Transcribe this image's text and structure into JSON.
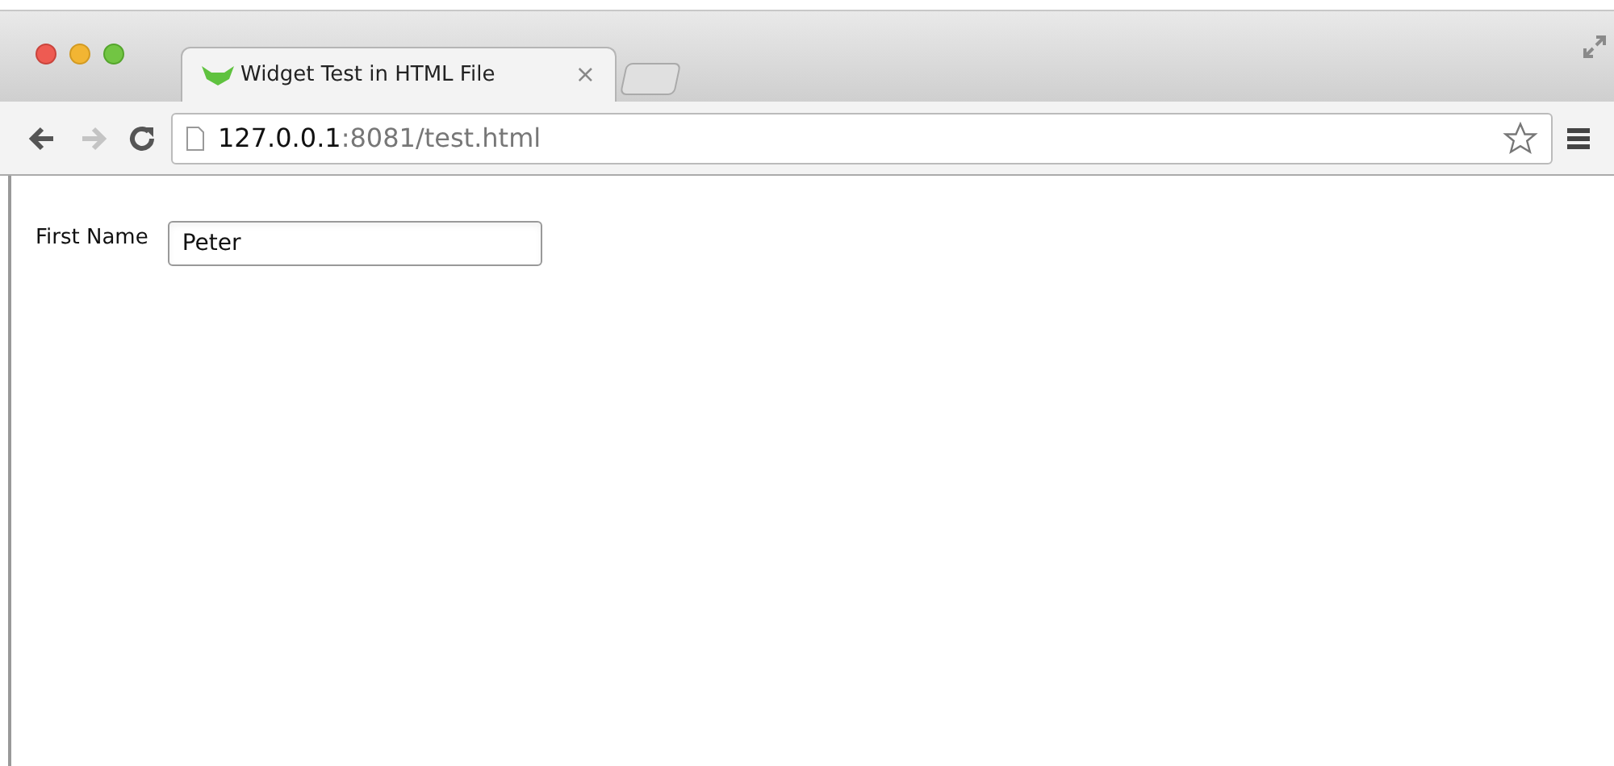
{
  "tabs": [
    {
      "title": "Widget Test in HTML File",
      "close": "×",
      "selected": true
    }
  ],
  "toolbar": {
    "back": {
      "disabled": false
    },
    "forward": {
      "disabled": true
    },
    "url_host": "127.0.0.1",
    "url_path": ":8081/test.html"
  },
  "form": {
    "label": "First Name",
    "value": "Peter"
  }
}
